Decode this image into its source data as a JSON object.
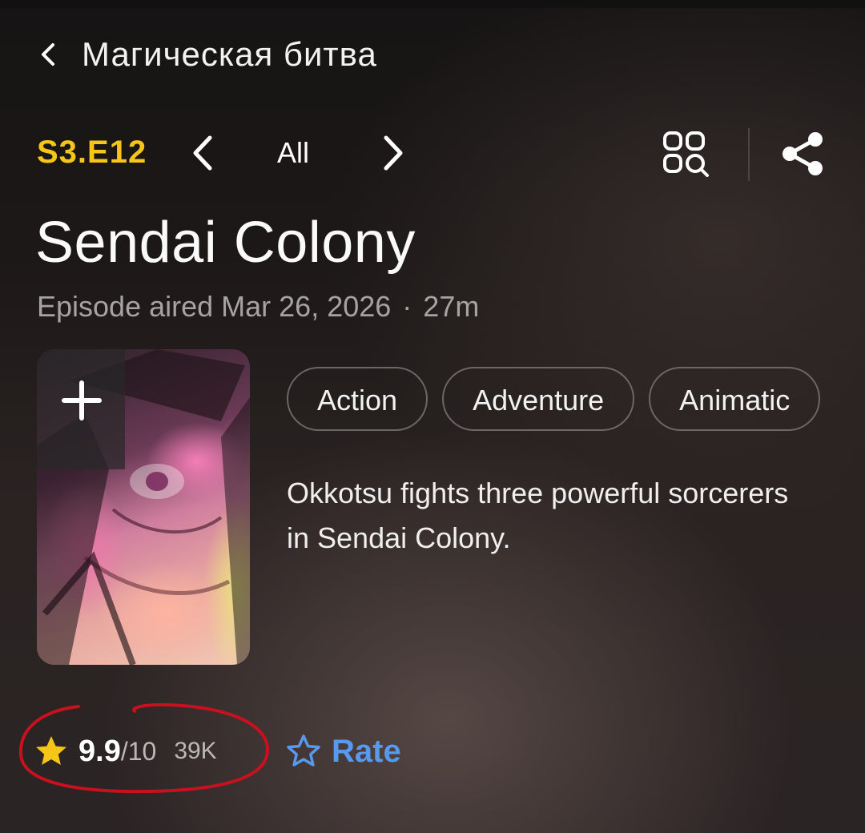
{
  "header": {
    "back_title": "Магическая битва"
  },
  "episode_nav": {
    "code": "S3.E12",
    "all_label": "All"
  },
  "episode": {
    "title": "Sendai Colony",
    "aired": "Episode aired Mar 26, 2026",
    "separator": "·",
    "runtime": "27m",
    "description": "Okkotsu fights three powerful sorcerers in Sendai Colony."
  },
  "genres": [
    "Action",
    "Adventure",
    "Animatic"
  ],
  "rating": {
    "value": "9.9",
    "max": "/10",
    "count": "39K",
    "rate_label": "Rate"
  },
  "colors": {
    "accent_yellow": "#f5c518",
    "rate_blue": "#5799ef",
    "annotation_red": "#c8101e"
  },
  "icons": [
    "chevron-left-icon",
    "grid-search-icon",
    "share-icon",
    "plus-icon",
    "star-filled-icon",
    "star-outline-icon"
  ]
}
